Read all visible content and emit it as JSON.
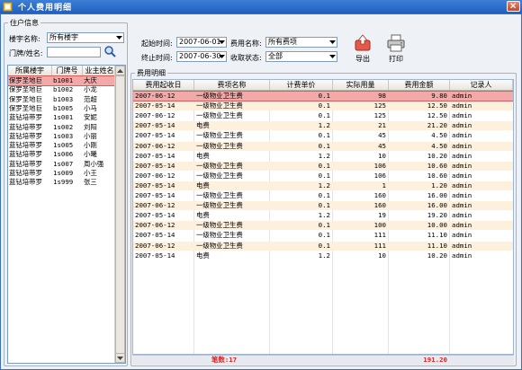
{
  "window": {
    "title": "个人费用明细"
  },
  "owner_group": {
    "legend": "住户信息",
    "building_label": "楼宇名称:",
    "building_value": "所有楼宇",
    "search_label": "门牌/姓名:",
    "search_value": ""
  },
  "owner_table": {
    "headers": [
      "所属楼宇",
      "门牌号",
      "业主姓名"
    ],
    "rows": [
      [
        "保罗圣地巨",
        "b1001",
        "大庆"
      ],
      [
        "保罗圣地巨",
        "b1002",
        "小龙"
      ],
      [
        "保罗圣地巨",
        "b1003",
        "范超"
      ],
      [
        "保罗圣地巨",
        "b1005",
        "小马"
      ],
      [
        "蓝钻培带罗",
        "1s001",
        "安妮"
      ],
      [
        "蓝钻培带罗",
        "1s002",
        "刘阳"
      ],
      [
        "蓝钻培带罗",
        "1s003",
        "小丽"
      ],
      [
        "蓝钻培带罗",
        "1s005",
        "小刚"
      ],
      [
        "蓝钻培带罗",
        "1s006",
        "小曦"
      ],
      [
        "蓝钻培带罗",
        "1s007",
        "周小强"
      ],
      [
        "蓝钻培带罗",
        "1s009",
        "小王"
      ],
      [
        "蓝钻培带罗",
        "1s999",
        "张三"
      ]
    ]
  },
  "filters": {
    "start_label": "起始时间:",
    "start_value": "2007-06-01",
    "end_label": "终止时间:",
    "end_value": "2007-06-30",
    "fee_name_label": "费用名称:",
    "fee_name_value": "所有费项",
    "status_label": "收取状态:",
    "status_value": "全部"
  },
  "toolbar": {
    "export_label": "导出",
    "print_label": "打印"
  },
  "detail": {
    "legend": "费用明细",
    "headers": [
      "费用起收日",
      "费项名称",
      "计费单价",
      "实际用量",
      "费用金额",
      "记录人"
    ],
    "rows": [
      [
        "2007-06-12",
        "一级物业卫生费",
        "0.1",
        "98",
        "9.80",
        "admin"
      ],
      [
        "2007-05-14",
        "一级物业卫生费",
        "0.1",
        "125",
        "12.50",
        "admin"
      ],
      [
        "2007-06-12",
        "一级物业卫生费",
        "0.1",
        "125",
        "12.50",
        "admin"
      ],
      [
        "2007-05-14",
        "电费",
        "1.2",
        "21",
        "21.20",
        "admin"
      ],
      [
        "2007-05-14",
        "一级物业卫生费",
        "0.1",
        "45",
        "4.50",
        "admin"
      ],
      [
        "2007-06-12",
        "一级物业卫生费",
        "0.1",
        "45",
        "4.50",
        "admin"
      ],
      [
        "2007-05-14",
        "电费",
        "1.2",
        "10",
        "10.20",
        "admin"
      ],
      [
        "2007-05-14",
        "一级物业卫生费",
        "0.1",
        "106",
        "10.60",
        "admin"
      ],
      [
        "2007-06-12",
        "一级物业卫生费",
        "0.1",
        "106",
        "10.60",
        "admin"
      ],
      [
        "2007-05-14",
        "电费",
        "1.2",
        "1",
        "1.20",
        "admin"
      ],
      [
        "2007-05-14",
        "一级物业卫生费",
        "0.1",
        "160",
        "16.00",
        "admin"
      ],
      [
        "2007-06-12",
        "一级物业卫生费",
        "0.1",
        "160",
        "16.00",
        "admin"
      ],
      [
        "2007-05-14",
        "电费",
        "1.2",
        "19",
        "19.20",
        "admin"
      ],
      [
        "2007-06-12",
        "一级物业卫生费",
        "0.1",
        "100",
        "10.00",
        "admin"
      ],
      [
        "2007-05-14",
        "一级物业卫生费",
        "0.1",
        "111",
        "11.10",
        "admin"
      ],
      [
        "2007-06-12",
        "一级物业卫生费",
        "0.1",
        "111",
        "11.10",
        "admin"
      ],
      [
        "2007-05-14",
        "电费",
        "1.2",
        "10",
        "10.20",
        "admin"
      ]
    ],
    "footer_count": "笔数:17",
    "footer_total": "191.20"
  },
  "colors": {
    "title_bar": "#2a6ccf",
    "selected_row": "#f4a9a9",
    "alt_row": "#fdf0dd",
    "footer_text": "#e02020"
  },
  "icons": [
    "app-icon",
    "close-icon",
    "search-icon",
    "export-icon",
    "print-icon",
    "chevron-down-icon"
  ]
}
